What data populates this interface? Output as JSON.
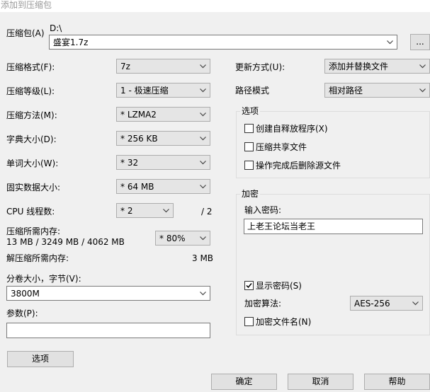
{
  "window": {
    "title": "添加到压缩包"
  },
  "archive": {
    "label": "压缩包(A)",
    "path": "D:\\",
    "filename": "盛宴1.7z",
    "browse_label": "..."
  },
  "left": {
    "format_label": "压缩格式(F):",
    "format_value": "7z",
    "level_label": "压缩等级(L):",
    "level_value": "1 - 极速压缩",
    "method_label": "压缩方法(M):",
    "method_value": "* LZMA2",
    "dict_label": "字典大小(D):",
    "dict_value": "* 256 KB",
    "word_label": "单词大小(W):",
    "word_value": "* 32",
    "solid_label": "固实数据大小:",
    "solid_value": "* 64 MB",
    "cpu_label": "CPU 线程数:",
    "cpu_value": "* 2",
    "cpu_total": "/ 2",
    "mem_label": "压缩所需内存:",
    "mem_value": "13 MB / 3249 MB / 4062 MB",
    "mem_percent": "* 80%",
    "decomp_label": "解压缩所需内存:",
    "decomp_value": "3 MB",
    "split_label": "分卷大小，字节(V):",
    "split_value": "3800M",
    "params_label": "参数(P):",
    "params_value": "",
    "options_button": "选项"
  },
  "right": {
    "update_label": "更新方式(U):",
    "update_value": "添加并替换文件",
    "pathmode_label": "路径模式",
    "pathmode_value": "相对路径",
    "options_group": "选项",
    "opt_sfx": "创建自释放程序(X)",
    "opt_shared": "压缩共享文件",
    "opt_delete": "操作完成后删除源文件",
    "encrypt_group": "加密",
    "password_label": "输入密码:",
    "password_value": "上老王论坛当老王",
    "show_password": "显示密码(S)",
    "show_password_checked": true,
    "algo_label": "加密算法:",
    "algo_value": "AES-256",
    "encrypt_names": "加密文件名(N)",
    "encrypt_names_checked": false
  },
  "footer": {
    "ok": "确定",
    "cancel": "取消",
    "help": "帮助"
  }
}
